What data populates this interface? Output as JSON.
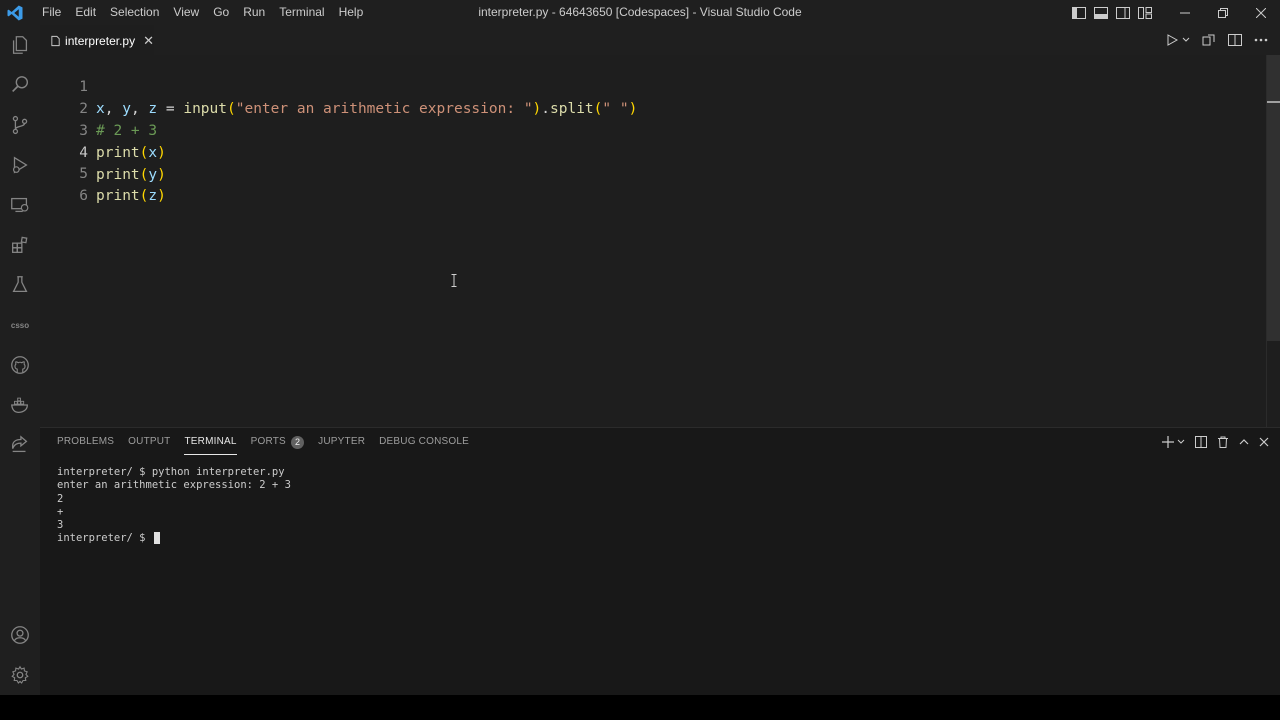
{
  "window": {
    "title": "interpreter.py - 64643650 [Codespaces] - Visual Studio Code",
    "menus": [
      "File",
      "Edit",
      "Selection",
      "View",
      "Go",
      "Run",
      "Terminal",
      "Help"
    ]
  },
  "activity_bar": {
    "items": [
      "explorer-icon",
      "search-icon",
      "source-control-icon",
      "run-debug-icon",
      "remote-explorer-icon",
      "extensions-icon",
      "testing-icon",
      "csso-icon",
      "github-icon",
      "docker-icon",
      "live-share-icon"
    ],
    "csso_label": "csso",
    "bottom": [
      "account-icon",
      "settings-gear-icon"
    ]
  },
  "tabs": [
    {
      "label": "interpreter.py",
      "close": "✕",
      "active": true
    }
  ],
  "editor": {
    "lines": [
      {
        "n": "1",
        "text": "x, y, z = input(\"enter an arithmetic expression: \").split(\" \")"
      },
      {
        "n": "2",
        "text": "# 2 + 3"
      },
      {
        "n": "3",
        "text": "print(x)"
      },
      {
        "n": "4",
        "text": "print(y)"
      },
      {
        "n": "5",
        "text": "print(z)"
      },
      {
        "n": "6",
        "text": ""
      }
    ],
    "current_line": "4"
  },
  "panel": {
    "tabs": [
      {
        "label": "PROBLEMS"
      },
      {
        "label": "OUTPUT"
      },
      {
        "label": "TERMINAL",
        "active": true
      },
      {
        "label": "PORTS",
        "badge": "2"
      },
      {
        "label": "JUPYTER"
      },
      {
        "label": "DEBUG CONSOLE"
      }
    ],
    "terminal_lines": [
      "interpreter/ $ python interpreter.py",
      "enter an arithmetic expression: 2 + 3",
      "2",
      "+",
      "3",
      "interpreter/ $ "
    ]
  },
  "colors": {
    "accent": "#0078d4",
    "editor_bg": "#1e1e1e",
    "panel_bg": "#181818",
    "chrome_bg": "#1f1f1f"
  }
}
